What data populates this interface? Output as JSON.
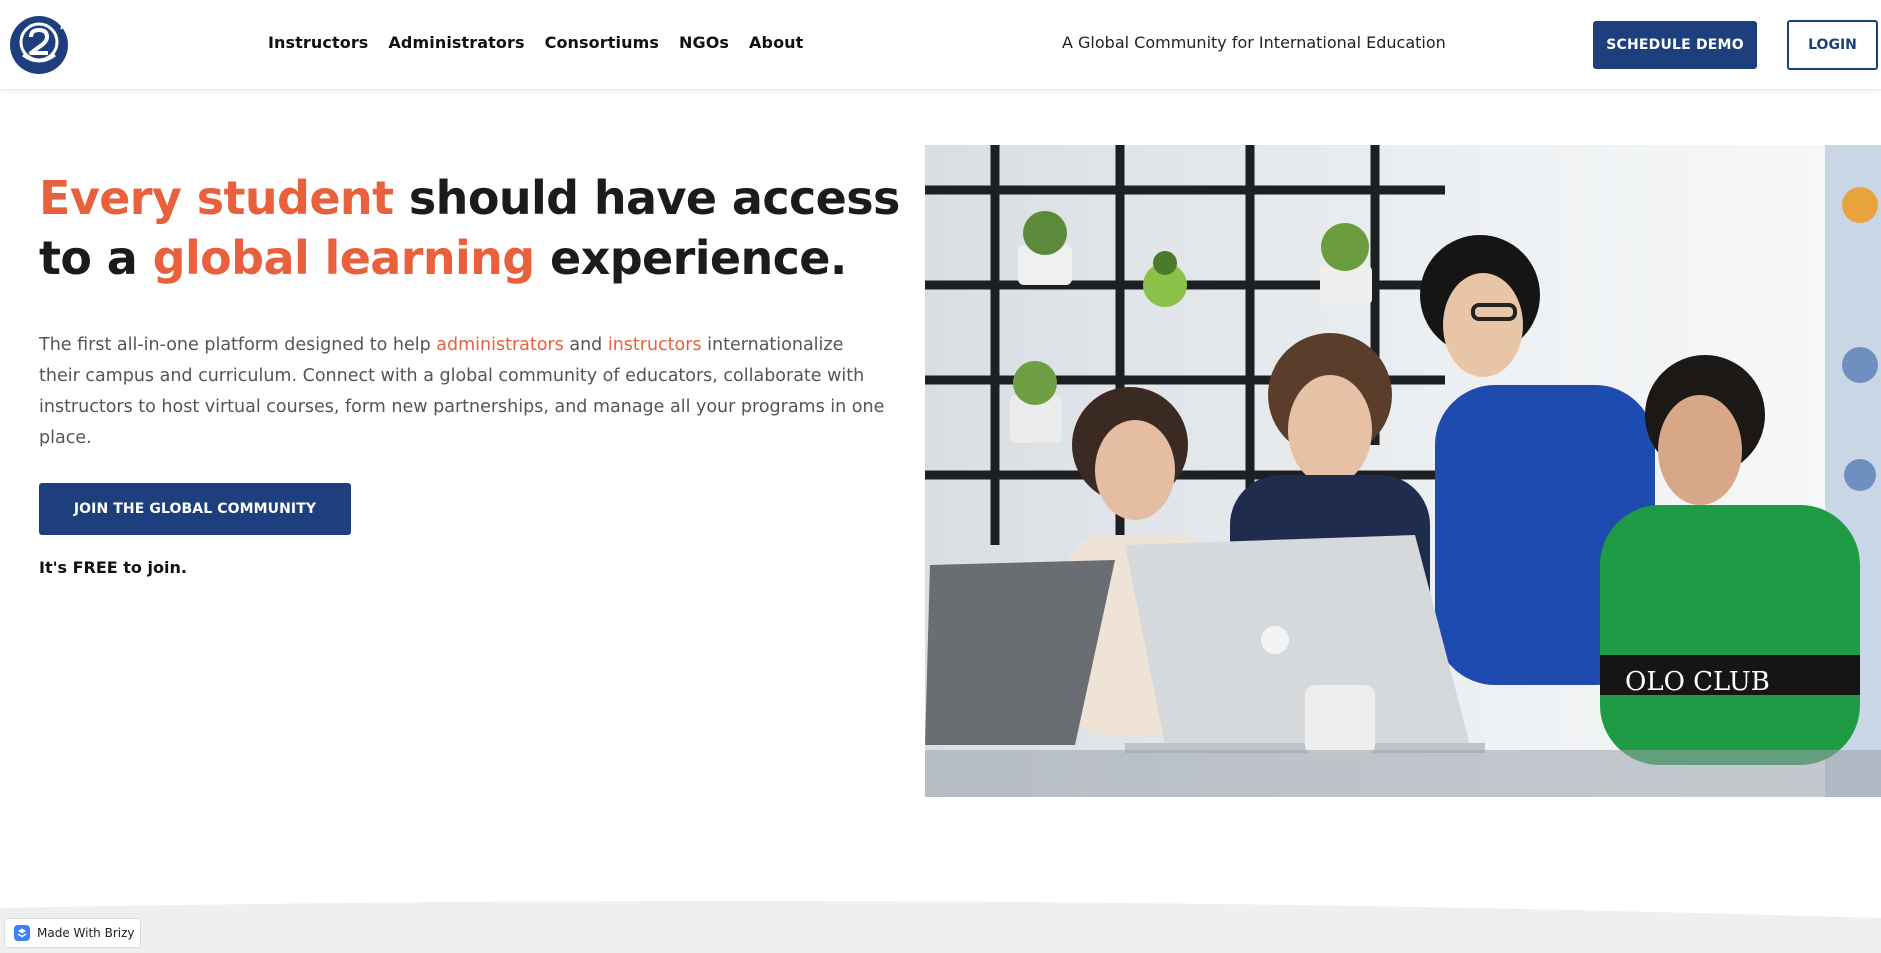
{
  "header": {
    "logo_icon": "globe-2-logo-icon",
    "nav": [
      {
        "label": "Instructors"
      },
      {
        "label": "Administrators"
      },
      {
        "label": "Consortiums"
      },
      {
        "label": "NGOs"
      },
      {
        "label": "About"
      }
    ],
    "tagline": "A Global Community for International Education",
    "schedule_demo_label": "SCHEDULE DEMO",
    "login_label": "LOGIN"
  },
  "hero": {
    "title_part1": "Every student",
    "title_part2": " should have access to a ",
    "title_part3": "global learning",
    "title_part4": " experience.",
    "desc_part1": "The first all-in-one platform designed to help ",
    "desc_link1": "administrators",
    "desc_part2": " and ",
    "desc_link2": "instructors",
    "desc_part3": " internationalize their campus and curriculum. Connect with a global community of educators, collaborate with instructors to host virtual courses, form new partnerships, and manage all your programs in one place.",
    "join_label": "JOIN THE GLOBAL COMMUNITY",
    "free_note": "It's FREE to join."
  },
  "badge": {
    "label": "Made With Brizy",
    "icon": "brizy-icon"
  },
  "colors": {
    "accent": "#e8603c",
    "brand_blue": "#1e3f7d"
  }
}
